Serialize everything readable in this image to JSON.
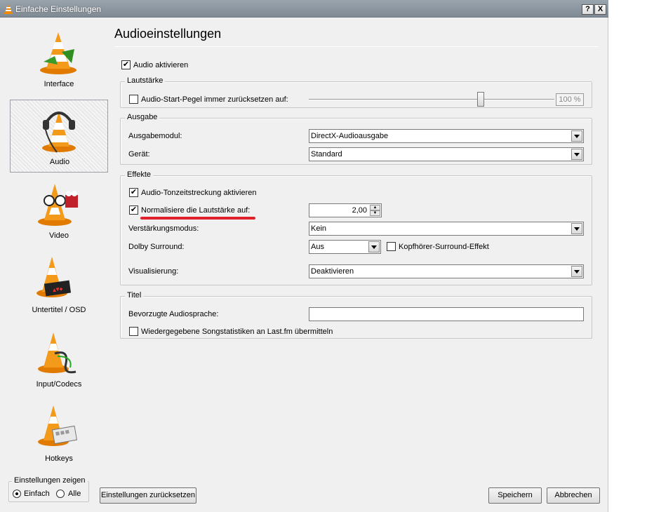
{
  "window": {
    "title": "Einfache Einstellungen",
    "help_label": "?",
    "close_label": "X"
  },
  "sidebar": {
    "items": [
      {
        "label": "Interface",
        "icon": "vlc-cone-interface-icon"
      },
      {
        "label": "Audio",
        "icon": "vlc-cone-headphones-icon",
        "selected": true
      },
      {
        "label": "Video",
        "icon": "vlc-cone-glasses-icon"
      },
      {
        "label": "Untertitel / OSD",
        "icon": "vlc-cone-subtitle-icon"
      },
      {
        "label": "Input/Codecs",
        "icon": "vlc-cone-cable-icon"
      },
      {
        "label": "Hotkeys",
        "icon": "vlc-cone-keyboard-icon"
      }
    ]
  },
  "page": {
    "title": "Audioeinstellungen"
  },
  "audio_enable": {
    "label": "Audio aktivieren",
    "checked": true
  },
  "volume": {
    "legend": "Lautstärke",
    "reset_label": "Audio-Start-Pegel immer zurücksetzen auf:",
    "reset_checked": false,
    "level": "100 %",
    "slider_fraction": 0.7
  },
  "output": {
    "legend": "Ausgabe",
    "module_label": "Ausgabemodul:",
    "module_value": "DirectX-Audioausgabe",
    "device_label": "Gerät:",
    "device_value": "Standard"
  },
  "effects": {
    "legend": "Effekte",
    "timestretch_label": "Audio-Tonzeitstreckung aktivieren",
    "timestretch_checked": true,
    "normalize_label": "Normalisiere die Lautstärke auf:",
    "normalize_checked": true,
    "normalize_value": "2,00",
    "gain_label": "Verstärkungsmodus:",
    "gain_value": "Kein",
    "dolby_label": "Dolby Surround:",
    "dolby_value": "Aus",
    "headphone_label": "Kopfhörer-Surround-Effekt",
    "headphone_checked": false,
    "visual_label": "Visualisierung:",
    "visual_value": "Deaktivieren"
  },
  "tracks": {
    "legend": "Titel",
    "language_label": "Bevorzugte Audiosprache:",
    "language_value": "",
    "lastfm_label": "Wiedergegebene Songstatistiken an Last.fm übermitteln",
    "lastfm_checked": false
  },
  "show_settings": {
    "legend": "Einstellungen zeigen",
    "simple_label": "Einfach",
    "all_label": "Alle",
    "selected": "simple"
  },
  "buttons": {
    "reset": "Einstellungen zurücksetzen",
    "save": "Speichern",
    "cancel": "Abbrechen"
  },
  "colors": {
    "annotation_underline": "#e0202a",
    "titlebar": "#8c969f",
    "cone_orange": "#f08a00"
  }
}
